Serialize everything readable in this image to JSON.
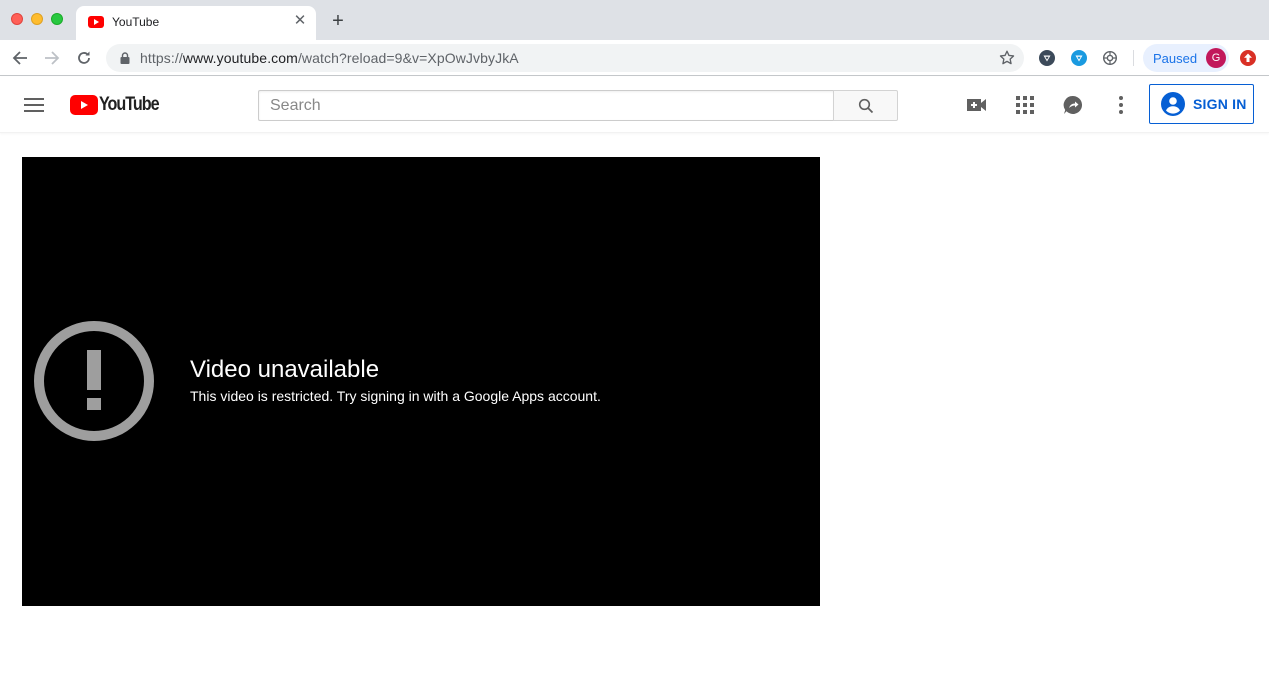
{
  "browser": {
    "tab": {
      "title": "YouTube"
    },
    "url": {
      "scheme": "https://",
      "host": "www.youtube.com",
      "path": "/watch?reload=9&v=XpOwJvbyJkA"
    },
    "profile": {
      "paused_label": "Paused",
      "avatar_initial": "G"
    }
  },
  "masthead": {
    "logo_text": "YouTube",
    "search": {
      "placeholder": "Search",
      "value": ""
    },
    "signin_label": "SIGN IN"
  },
  "player": {
    "error_title": "Video unavailable",
    "error_subtitle": "This video is restricted. Try signing in with a Google Apps account."
  },
  "colors": {
    "brand_red": "#ff0000",
    "signin_blue": "#065fd4",
    "error_icon_gray": "#9e9e9e"
  }
}
